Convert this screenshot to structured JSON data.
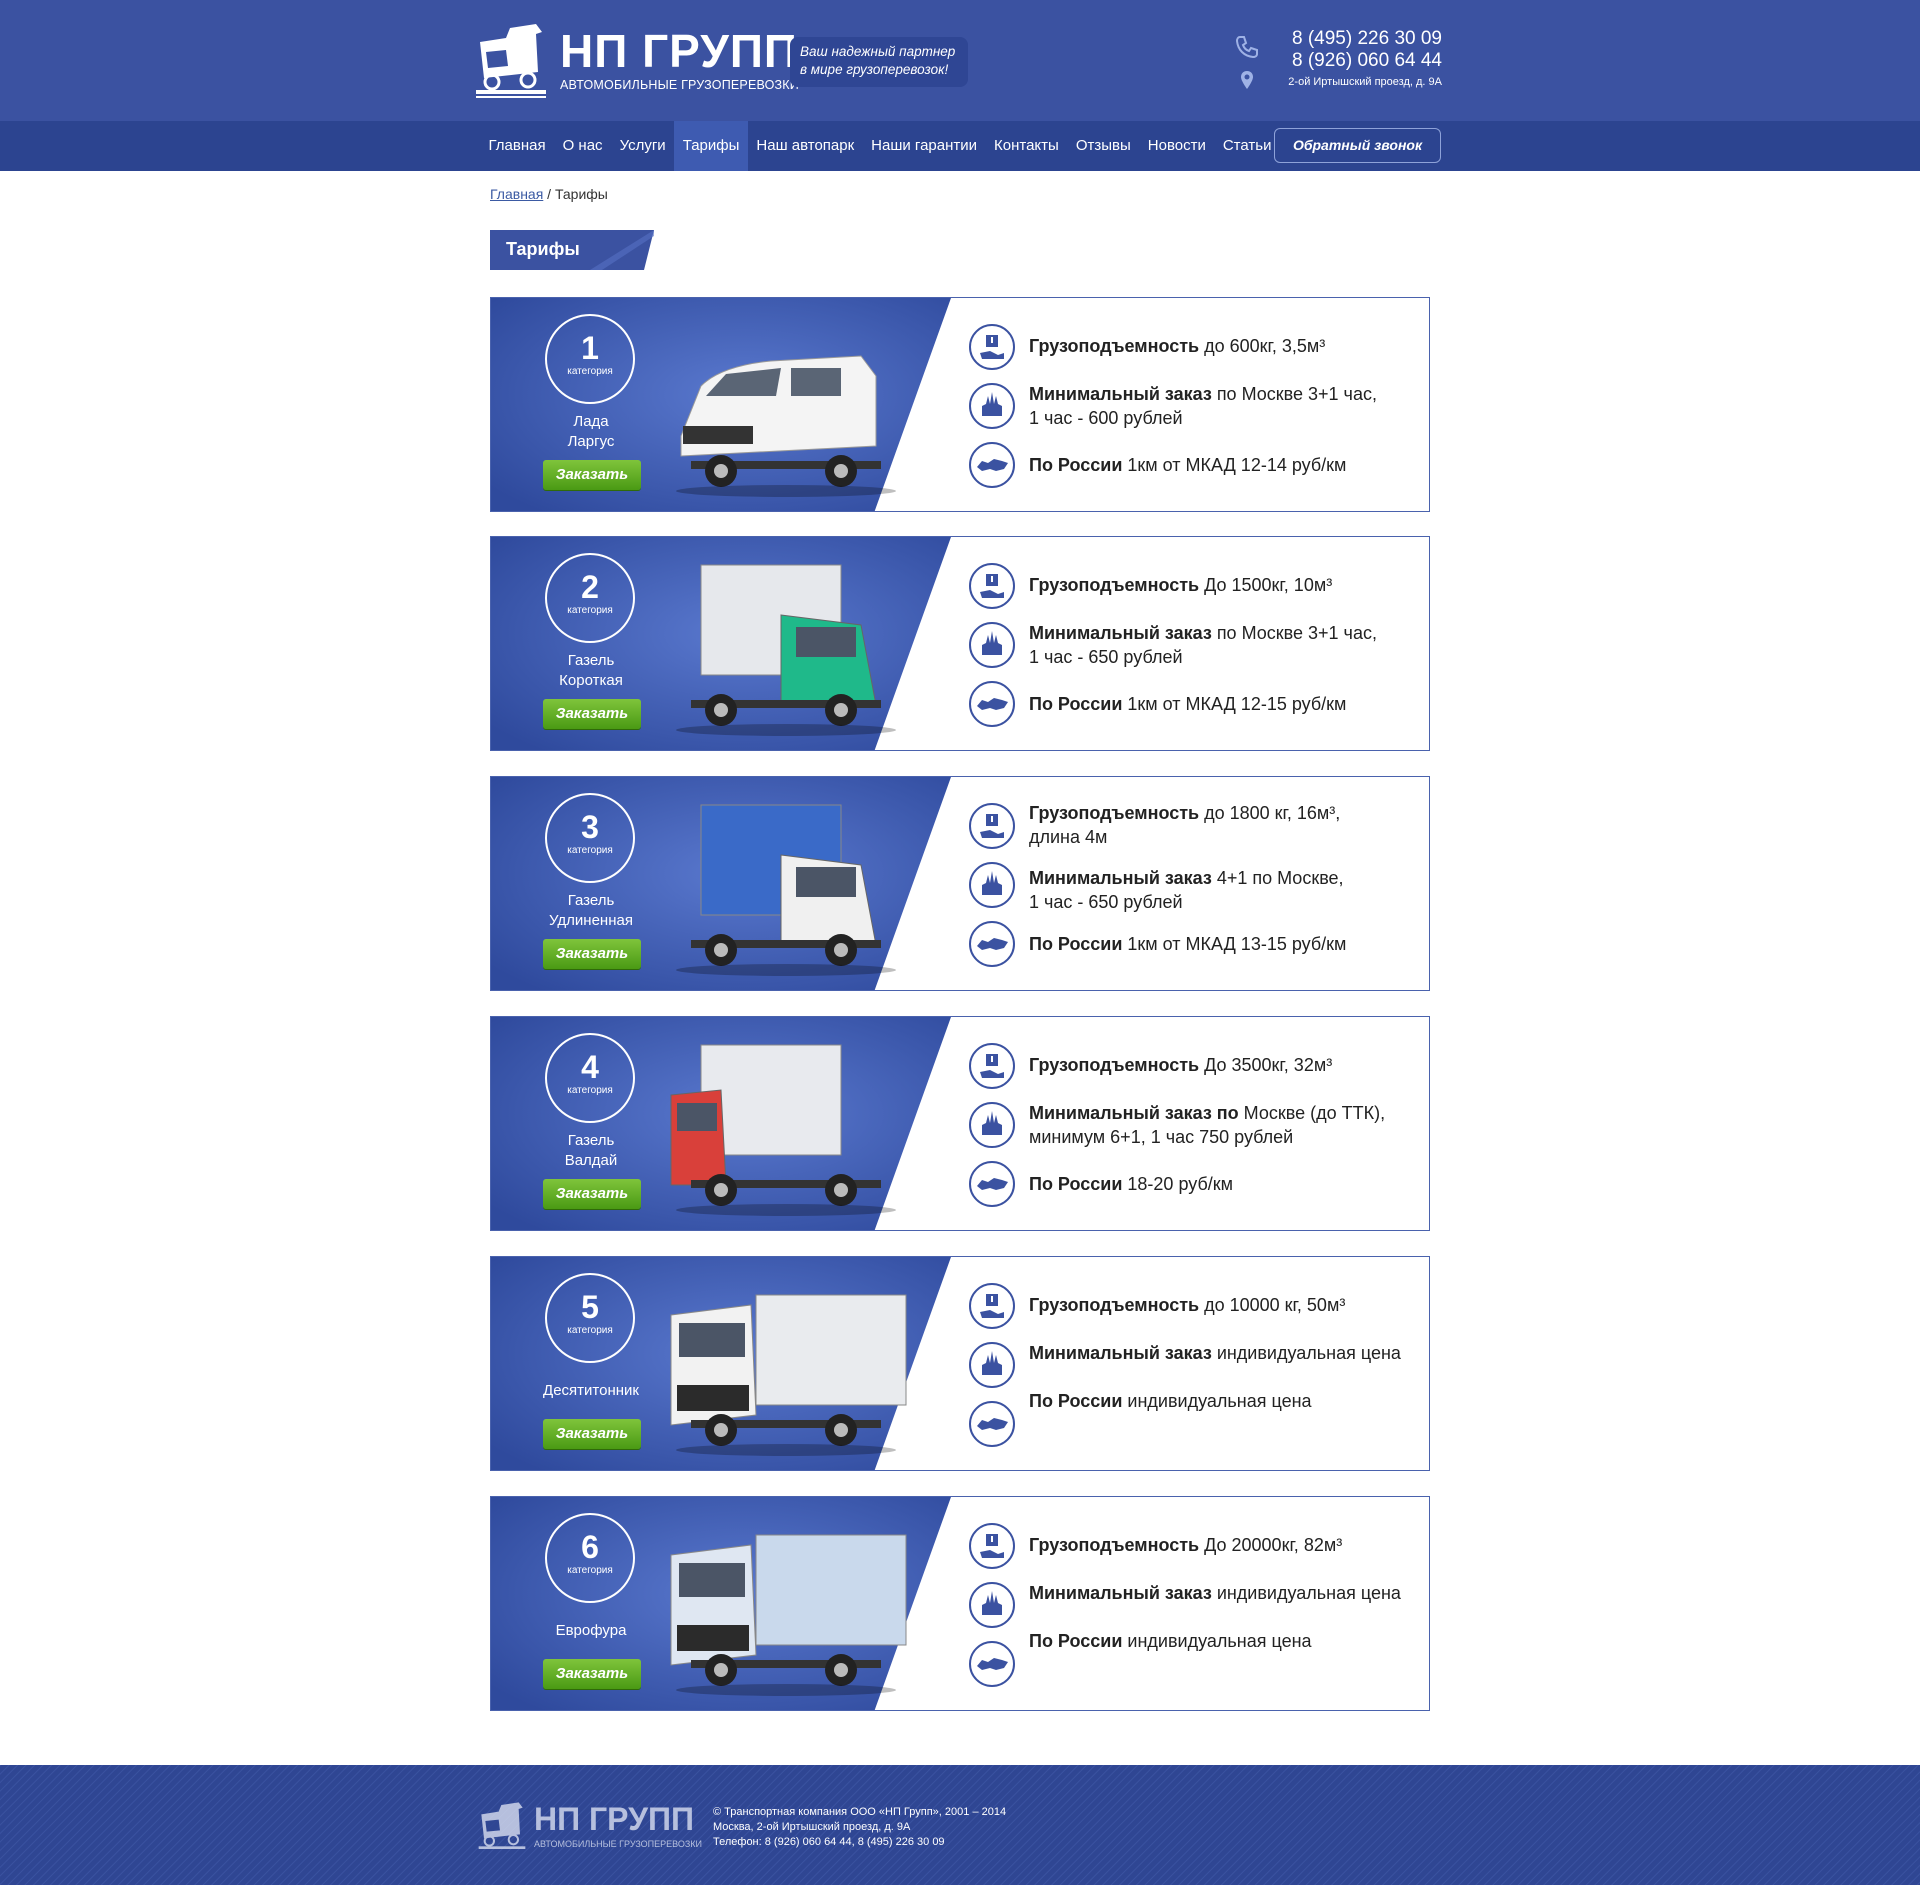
{
  "header": {
    "logo_title": "НП ГРУПП",
    "logo_subtitle": "АВТОМОБИЛЬНЫЕ ГРУЗОПЕРЕВОЗКИ",
    "slogan_line1": "Ваш надежный партнер",
    "slogan_line2": "в мире грузоперевозок!",
    "phone1": "8 (495) 226 30 09",
    "phone2": "8 (926) 060 64 44",
    "address": "2-ой Иртышский проезд, д. 9А"
  },
  "nav": {
    "items": [
      "Главная",
      "О нас",
      "Услуги",
      "Тарифы",
      "Наш автопарк",
      "Наши гарантии",
      "Контакты",
      "Отзывы",
      "Новости",
      "Статьи"
    ],
    "active": "Тарифы",
    "callback_label": "Обратный звонок"
  },
  "breadcrumb": {
    "home": "Главная",
    "separator": " / ",
    "current": "Тарифы"
  },
  "page_title": "Тарифы",
  "category_label": "категория",
  "order_label": "Заказать",
  "tariffs": [
    {
      "num": "1",
      "name_line1": "Лада",
      "name_line2": "Ларгус",
      "cap_label": "Грузоподъемность",
      "cap_line1": " до 600кг, 3,5м³",
      "cap_line2": "",
      "min_label": "Минимальный заказ",
      "min_line1": " по Москве 3+1 час,",
      "min_line2": "1 час - 600 рублей",
      "rus_label": "По России",
      "rus_value": " 1км от МКАД 12-14 руб/км"
    },
    {
      "num": "2",
      "name_line1": "Газель",
      "name_line2": "Короткая",
      "cap_label": "Грузоподъемность",
      "cap_line1": " До 1500кг, 10м³",
      "cap_line2": "",
      "min_label": "Минимальный заказ",
      "min_line1": " по Москве 3+1 час,",
      "min_line2": "1 час - 650 рублей",
      "rus_label": "По России",
      "rus_value": " 1км от МКАД 12-15 руб/км"
    },
    {
      "num": "3",
      "name_line1": "Газель",
      "name_line2": "Удлиненная",
      "cap_label": "Грузоподъемность",
      "cap_line1": " до 1800 кг, 16м³,",
      "cap_line2": "длина 4м",
      "min_label": "Минимальный заказ",
      "min_line1": " 4+1 по Москве,",
      "min_line2": "1 час - 650 рублей",
      "rus_label": "По России",
      "rus_value": " 1км от МКАД 13-15 руб/км"
    },
    {
      "num": "4",
      "name_line1": "Газель",
      "name_line2": "Валдай",
      "cap_label": "Грузоподъемность",
      "cap_line1": " До 3500кг, 32м³",
      "cap_line2": "",
      "min_label": "Минимальный заказ по",
      "min_line1": " Москве (до ТТК),",
      "min_line2": "минимум 6+1, 1 час 750 рублей",
      "rus_label": "По России",
      "rus_value": " 18-20 руб/км"
    },
    {
      "num": "5",
      "name_line1": "Десятитонник",
      "name_line2": "",
      "cap_label": "Грузоподъемность",
      "cap_line1": " до 10000 кг, 50м³",
      "cap_line2": "",
      "min_label": "Минимальный заказ",
      "min_line1": " индивидуальная цена",
      "min_line2": "",
      "rus_label": "По России",
      "rus_value": " индивидуальная цена"
    },
    {
      "num": "6",
      "name_line1": "Еврофура",
      "name_line2": "",
      "cap_label": "Грузоподъемность",
      "cap_line1": " До 20000кг, 82м³",
      "cap_line2": "",
      "min_label": "Минимальный заказ",
      "min_line1": "  индивидуальная цена",
      "min_line2": "",
      "rus_label": "По России",
      "rus_value": " индивидуальная цена"
    }
  ],
  "footer": {
    "logo_title": "НП ГРУПП",
    "logo_subtitle": "АВТОМОБИЛЬНЫЕ ГРУЗОПЕРЕВОЗКИ",
    "line1": "© Транспортная компания ООО «НП Групп», 2001 – 2014",
    "line2": "Москва, 2-ой Иртышский проезд, д. 9А",
    "line3": "Телефон: 8 (926) 060 64 44,  8 (495) 226 30 09"
  },
  "colors": {
    "header_bg": "#3b52a1",
    "nav_bg": "#2c4490",
    "accent_blue": "#3e5bb1",
    "order_green": "#5aa81f",
    "card_border": "#4a62ad"
  }
}
